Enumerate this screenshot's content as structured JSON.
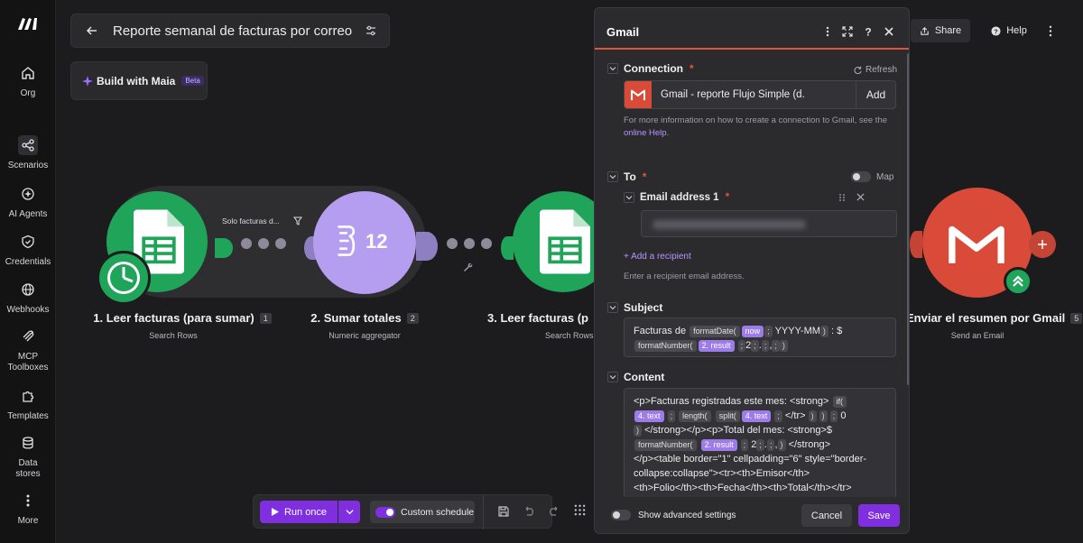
{
  "sidebar": {
    "items": [
      {
        "label": "Org",
        "icon": "home-icon"
      },
      {
        "label": "Scenarios",
        "icon": "share-nodes-icon"
      },
      {
        "label": "AI Agents",
        "icon": "ai-sparkle-icon"
      },
      {
        "label": "Credentials",
        "icon": "shield-check-icon"
      },
      {
        "label": "Webhooks",
        "icon": "globe-icon"
      },
      {
        "label": "MCP Toolboxes",
        "icon": "mcp-icon"
      },
      {
        "label": "Templates",
        "icon": "puzzle-icon"
      },
      {
        "label": "Data stores",
        "icon": "database-icon"
      },
      {
        "label": "More",
        "icon": "more-vertical-icon"
      }
    ]
  },
  "header": {
    "title": "Reporte semanal de facturas por correo",
    "maia_label": "Build with Maia",
    "maia_badge": "Beta",
    "share_label": "Share",
    "help_label": "Help"
  },
  "modules": [
    {
      "label": "1. Leer facturas (para sumar)",
      "num": "1",
      "sub": "Search Rows"
    },
    {
      "label": "2. Sumar totales",
      "num": "2",
      "sub": "Numeric aggregator",
      "icon_text": "12"
    },
    {
      "label": "3. Leer facturas (p",
      "num": "3",
      "sub": "Search Rows"
    },
    {
      "label": "Enviar el resumen por Gmail",
      "num": "5",
      "sub": "Send an Email"
    }
  ],
  "filter_label": "Solo facturas d...",
  "toolbar": {
    "run_once": "Run once",
    "custom_schedule": "Custom schedule"
  },
  "panel": {
    "title": "Gmail",
    "connection_label": "Connection",
    "refresh_label": "Refresh",
    "connection_value": "Gmail - reporte Flujo Simple (d.",
    "add_label": "Add",
    "help_text_prefix": "For more information on how to create a connection to Gmail, see the",
    "help_link": "online Help",
    "help_text_suffix": ".",
    "to_label": "To",
    "map_label": "Map",
    "email_label": "Email address 1",
    "add_recipient": "+ Add a recipient",
    "recipient_help": "Enter a recipient email address.",
    "subject_label": "Subject",
    "content_label": "Content",
    "show_advanced": "Show advanced settings",
    "cancel": "Cancel",
    "save": "Save",
    "subject": {
      "t1": "Facturas de",
      "f1": "formatDate(",
      "v1": "now",
      "s1": ";",
      "t2": "YYYY-MM",
      "c1": ")",
      "t3": ": $",
      "f2": "formatNumber(",
      "v2": "2. result",
      "s2": ";",
      "t4": "2",
      "s3": ";",
      "t5": ".",
      "s4": ";",
      "t6": ",",
      "s5": ";",
      "c2": ")"
    },
    "content": {
      "l1a": "<p>Facturas registradas este mes: <strong>",
      "l1b": "if(",
      "l2a": "4. text",
      "l2b": ";",
      "l2c": "length(",
      "l2d": "split(",
      "l2e": "4. text",
      "l2f": ";",
      "l2g": "</tr>",
      "l2h": ")",
      "l2i": ")",
      "l2j": ";",
      "l2k": "0",
      "l3a": ")",
      "l3b": "</strong></p><p>Total del mes: <strong>$",
      "l4a": "formatNumber(",
      "l4b": "2. result",
      "l4c": ";",
      "l4d": "2",
      "l4e": ";",
      "l4f": ".",
      "l4g": ";",
      "l4h": ",",
      "l4i": ")",
      "l4j": "</strong>",
      "l5": "</p><table border=\"1\" cellpadding=\"6\" style=\"border-collapse:collapse\"><tr><th>Emisor</th>",
      "l6": "<th>Folio</th><th>Fecha</th><th>Total</th></tr>"
    }
  },
  "colors": {
    "accent": "#7f2fe0",
    "sheets": "#20a45a",
    "aggregator": "#b59ef0",
    "gmail": "#d94a38"
  }
}
